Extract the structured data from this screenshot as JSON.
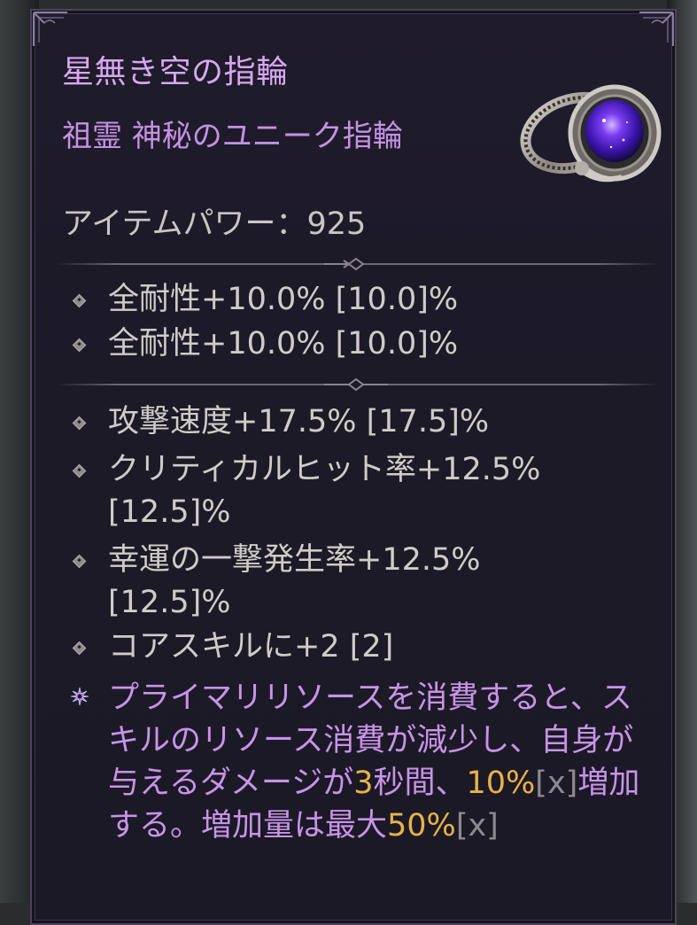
{
  "item": {
    "name": "星無き空の指輪",
    "type_line": "祖霊 神秘のユニーク指輪",
    "item_power_label": "アイテムパワー：",
    "item_power_value": "925"
  },
  "implicit_stats": [
    {
      "text": "全耐性+10.0% [10.0]%"
    },
    {
      "text": "全耐性+10.0% [10.0]%"
    }
  ],
  "affix_stats": [
    {
      "text": "攻撃速度+17.5% [17.5]%"
    },
    {
      "text": "クリティカルヒット率+12.5% [12.5]%"
    },
    {
      "text": "幸運の一撃発生率+12.5% [12.5]%"
    },
    {
      "text": "コアスキルに+2 [2]"
    }
  ],
  "unique_power": {
    "part1": "プライマリリソースを消費すると、スキルのリソース消費が減少し、自身が与えるダメージが",
    "duration": "3",
    "part2": "秒間、",
    "amount": "10%",
    "bracket1": "[x]",
    "part3": "増加する。増加量は最大",
    "max": "50%",
    "bracket2": "[x]"
  },
  "colors": {
    "title": "#d7a7f0",
    "unique_text": "#c893e8",
    "highlight": "#e8b24a",
    "stat_text": "#cfccc8",
    "background": "#1c1a27"
  },
  "icons": {
    "item": "ring-icon",
    "stat_bullet": "diamond-bullet-icon",
    "unique_bullet": "unique-star-icon",
    "divider": "ornament-divider-icon"
  }
}
